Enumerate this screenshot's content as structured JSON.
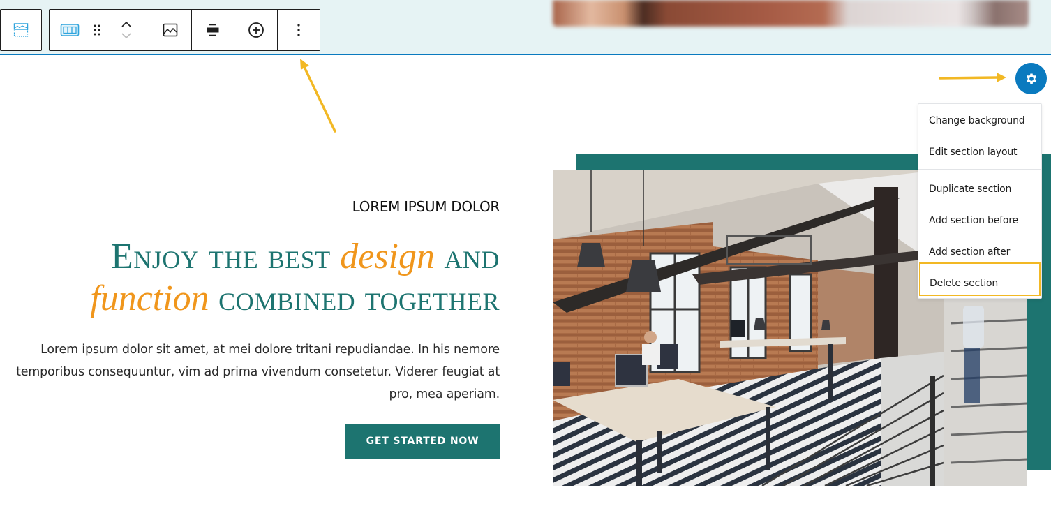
{
  "toolbar": {
    "block_type": {
      "icon": "cover-block-icon",
      "label": "Cover block"
    },
    "buttons": [
      {
        "name": "columns-layout",
        "icon": "columns-icon"
      },
      {
        "name": "drag-handle",
        "icon": "drag-handle-icon"
      },
      {
        "name": "move-up",
        "icon": "chevron-up-icon"
      },
      {
        "name": "move-down",
        "icon": "chevron-down-icon"
      },
      {
        "name": "replace-image",
        "icon": "image-icon"
      },
      {
        "name": "align",
        "icon": "align-center-icon"
      },
      {
        "name": "add-block",
        "icon": "plus-circle-icon"
      },
      {
        "name": "more-options",
        "icon": "more-vertical-icon"
      }
    ]
  },
  "section_menu": {
    "trigger_icon": "gear-icon",
    "items": [
      {
        "label": "Change background"
      },
      {
        "label": "Edit section layout"
      },
      {
        "label": "Duplicate section"
      },
      {
        "label": "Add section before"
      },
      {
        "label": "Add section after"
      },
      {
        "label": "Delete section",
        "highlighted": true
      }
    ]
  },
  "hero": {
    "eyebrow": "LOREM IPSUM DOLOR",
    "headline": {
      "part1": "Enjoy the best ",
      "accent1": "design",
      "part2": " and",
      "accent2": "function",
      "part3": " combined together"
    },
    "body": "Lorem ipsum dolor sit amet, at mei dolore tritani repudiandae. In his nemore temporibus consequuntur, vim ad prima vivendum consetetur. Viderer feugiat at pro, mea aperiam.",
    "cta_label": "GET STARTED NOW",
    "image_alt": "Open-plan loft office with brick walls, pendant lamps, desks and a staircase"
  },
  "colors": {
    "brand_teal": "#1d7470",
    "accent_orange": "#f0961c",
    "editor_blue": "#0a7abf",
    "annotation_yellow": "#f2b824"
  }
}
